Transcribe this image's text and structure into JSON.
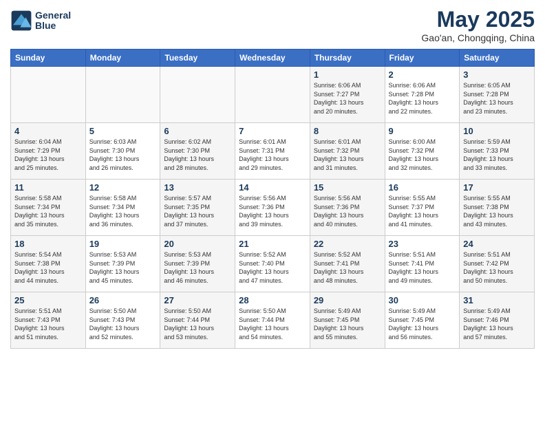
{
  "header": {
    "logo_line1": "General",
    "logo_line2": "Blue",
    "month": "May 2025",
    "location": "Gao'an, Chongqing, China"
  },
  "weekdays": [
    "Sunday",
    "Monday",
    "Tuesday",
    "Wednesday",
    "Thursday",
    "Friday",
    "Saturday"
  ],
  "weeks": [
    [
      {
        "day": "",
        "info": ""
      },
      {
        "day": "",
        "info": ""
      },
      {
        "day": "",
        "info": ""
      },
      {
        "day": "",
        "info": ""
      },
      {
        "day": "1",
        "info": "Sunrise: 6:06 AM\nSunset: 7:27 PM\nDaylight: 13 hours\nand 20 minutes."
      },
      {
        "day": "2",
        "info": "Sunrise: 6:06 AM\nSunset: 7:28 PM\nDaylight: 13 hours\nand 22 minutes."
      },
      {
        "day": "3",
        "info": "Sunrise: 6:05 AM\nSunset: 7:28 PM\nDaylight: 13 hours\nand 23 minutes."
      }
    ],
    [
      {
        "day": "4",
        "info": "Sunrise: 6:04 AM\nSunset: 7:29 PM\nDaylight: 13 hours\nand 25 minutes."
      },
      {
        "day": "5",
        "info": "Sunrise: 6:03 AM\nSunset: 7:30 PM\nDaylight: 13 hours\nand 26 minutes."
      },
      {
        "day": "6",
        "info": "Sunrise: 6:02 AM\nSunset: 7:30 PM\nDaylight: 13 hours\nand 28 minutes."
      },
      {
        "day": "7",
        "info": "Sunrise: 6:01 AM\nSunset: 7:31 PM\nDaylight: 13 hours\nand 29 minutes."
      },
      {
        "day": "8",
        "info": "Sunrise: 6:01 AM\nSunset: 7:32 PM\nDaylight: 13 hours\nand 31 minutes."
      },
      {
        "day": "9",
        "info": "Sunrise: 6:00 AM\nSunset: 7:32 PM\nDaylight: 13 hours\nand 32 minutes."
      },
      {
        "day": "10",
        "info": "Sunrise: 5:59 AM\nSunset: 7:33 PM\nDaylight: 13 hours\nand 33 minutes."
      }
    ],
    [
      {
        "day": "11",
        "info": "Sunrise: 5:58 AM\nSunset: 7:34 PM\nDaylight: 13 hours\nand 35 minutes."
      },
      {
        "day": "12",
        "info": "Sunrise: 5:58 AM\nSunset: 7:34 PM\nDaylight: 13 hours\nand 36 minutes."
      },
      {
        "day": "13",
        "info": "Sunrise: 5:57 AM\nSunset: 7:35 PM\nDaylight: 13 hours\nand 37 minutes."
      },
      {
        "day": "14",
        "info": "Sunrise: 5:56 AM\nSunset: 7:36 PM\nDaylight: 13 hours\nand 39 minutes."
      },
      {
        "day": "15",
        "info": "Sunrise: 5:56 AM\nSunset: 7:36 PM\nDaylight: 13 hours\nand 40 minutes."
      },
      {
        "day": "16",
        "info": "Sunrise: 5:55 AM\nSunset: 7:37 PM\nDaylight: 13 hours\nand 41 minutes."
      },
      {
        "day": "17",
        "info": "Sunrise: 5:55 AM\nSunset: 7:38 PM\nDaylight: 13 hours\nand 43 minutes."
      }
    ],
    [
      {
        "day": "18",
        "info": "Sunrise: 5:54 AM\nSunset: 7:38 PM\nDaylight: 13 hours\nand 44 minutes."
      },
      {
        "day": "19",
        "info": "Sunrise: 5:53 AM\nSunset: 7:39 PM\nDaylight: 13 hours\nand 45 minutes."
      },
      {
        "day": "20",
        "info": "Sunrise: 5:53 AM\nSunset: 7:39 PM\nDaylight: 13 hours\nand 46 minutes."
      },
      {
        "day": "21",
        "info": "Sunrise: 5:52 AM\nSunset: 7:40 PM\nDaylight: 13 hours\nand 47 minutes."
      },
      {
        "day": "22",
        "info": "Sunrise: 5:52 AM\nSunset: 7:41 PM\nDaylight: 13 hours\nand 48 minutes."
      },
      {
        "day": "23",
        "info": "Sunrise: 5:51 AM\nSunset: 7:41 PM\nDaylight: 13 hours\nand 49 minutes."
      },
      {
        "day": "24",
        "info": "Sunrise: 5:51 AM\nSunset: 7:42 PM\nDaylight: 13 hours\nand 50 minutes."
      }
    ],
    [
      {
        "day": "25",
        "info": "Sunrise: 5:51 AM\nSunset: 7:43 PM\nDaylight: 13 hours\nand 51 minutes."
      },
      {
        "day": "26",
        "info": "Sunrise: 5:50 AM\nSunset: 7:43 PM\nDaylight: 13 hours\nand 52 minutes."
      },
      {
        "day": "27",
        "info": "Sunrise: 5:50 AM\nSunset: 7:44 PM\nDaylight: 13 hours\nand 53 minutes."
      },
      {
        "day": "28",
        "info": "Sunrise: 5:50 AM\nSunset: 7:44 PM\nDaylight: 13 hours\nand 54 minutes."
      },
      {
        "day": "29",
        "info": "Sunrise: 5:49 AM\nSunset: 7:45 PM\nDaylight: 13 hours\nand 55 minutes."
      },
      {
        "day": "30",
        "info": "Sunrise: 5:49 AM\nSunset: 7:45 PM\nDaylight: 13 hours\nand 56 minutes."
      },
      {
        "day": "31",
        "info": "Sunrise: 5:49 AM\nSunset: 7:46 PM\nDaylight: 13 hours\nand 57 minutes."
      }
    ]
  ]
}
